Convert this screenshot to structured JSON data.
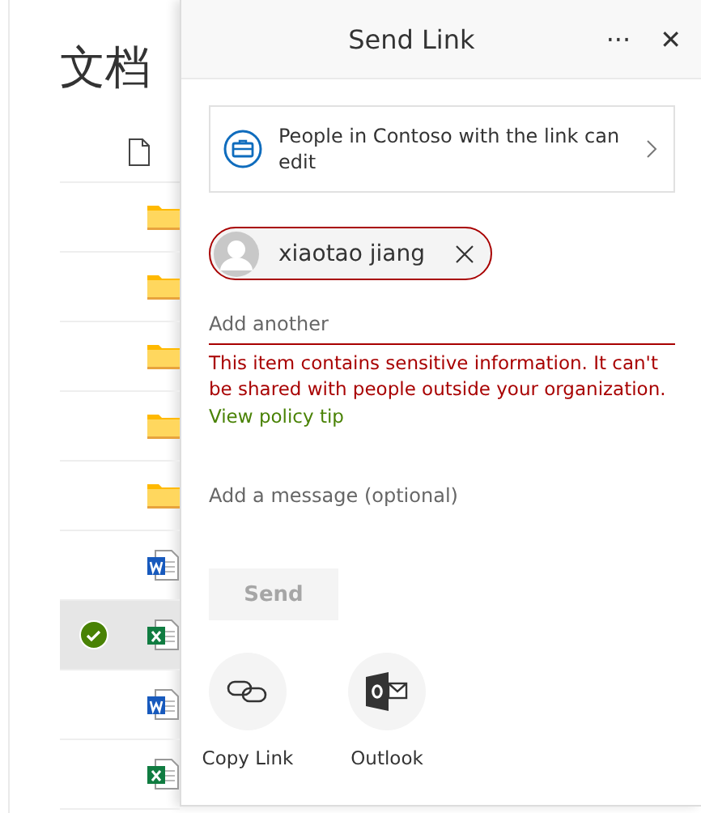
{
  "page": {
    "title": "文档"
  },
  "files": [
    {
      "kind": "folder",
      "selected": false
    },
    {
      "kind": "folder",
      "selected": false
    },
    {
      "kind": "folder",
      "selected": false
    },
    {
      "kind": "folder",
      "selected": false
    },
    {
      "kind": "folder",
      "selected": false
    },
    {
      "kind": "word",
      "selected": false
    },
    {
      "kind": "excel",
      "selected": true
    },
    {
      "kind": "word",
      "selected": false
    },
    {
      "kind": "excel",
      "selected": false
    }
  ],
  "panel": {
    "title": "Send Link",
    "more": "···",
    "close": "✕",
    "permission": "People in Contoso with the link can edit",
    "recipients": [
      {
        "name": "xiaotao jiang"
      }
    ],
    "add_placeholder": "Add another",
    "error": "This item contains sensitive information. It can't be shared with people outside your organization.",
    "policy_link": "View policy tip",
    "message_placeholder": "Add a message (optional)",
    "send": {
      "label": "Send",
      "disabled": true
    },
    "share_options": [
      {
        "kind": "copy",
        "label": "Copy Link"
      },
      {
        "kind": "outlook",
        "label": "Outlook"
      }
    ]
  }
}
